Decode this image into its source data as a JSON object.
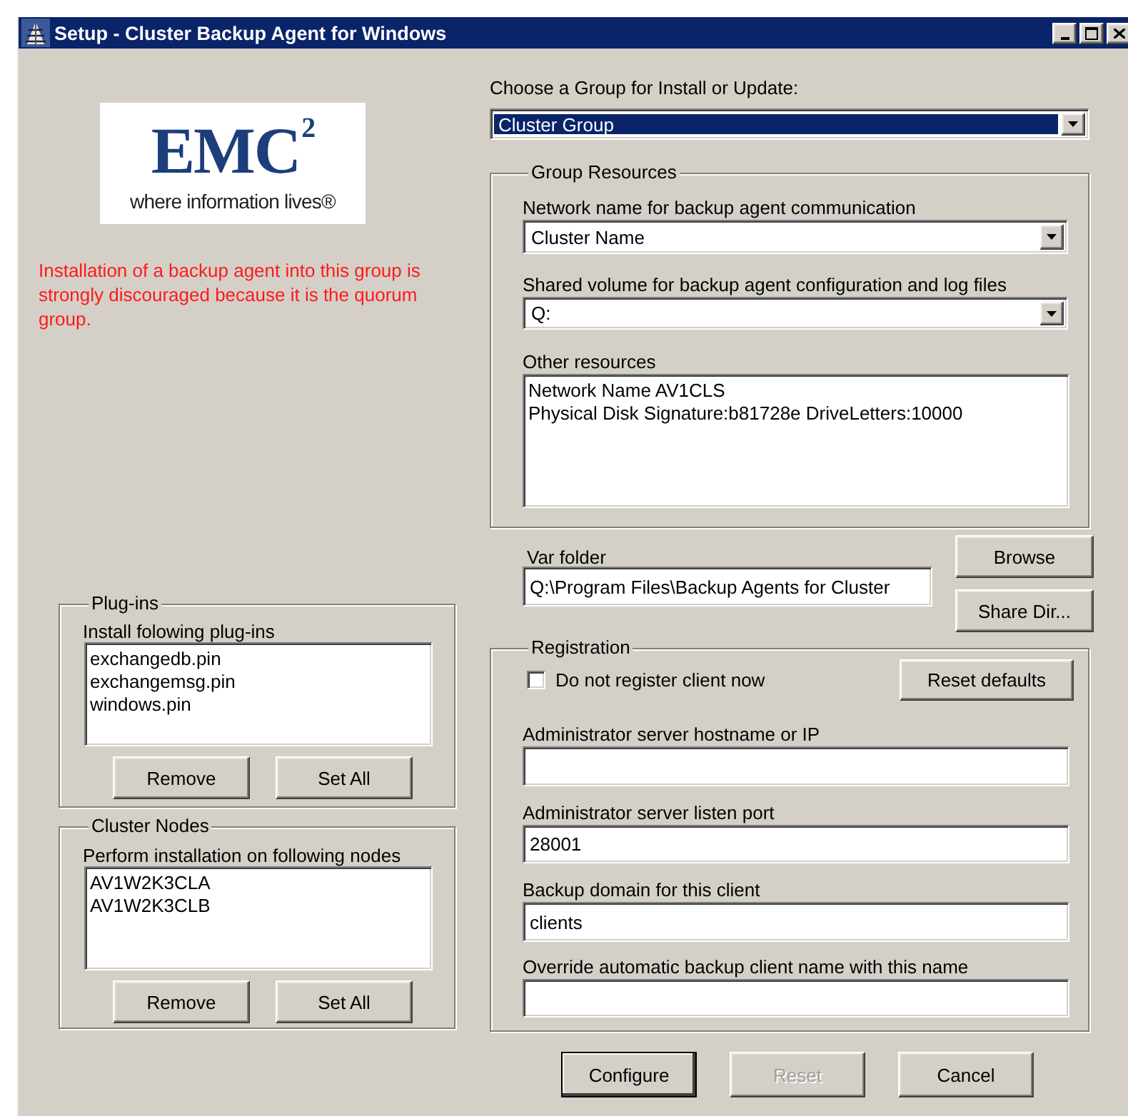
{
  "window": {
    "title": "Setup - Cluster Backup Agent for Windows"
  },
  "logo": {
    "wordmark": "EMC$^{2}$",
    "tagline": "where information lives®"
  },
  "warning": "Installation of a backup agent into this group is strongly discouraged because it is the quorum group.",
  "plugins": {
    "title": "Plug-ins",
    "label": "Install folowing plug-ins",
    "items": [
      "exchangedb.pin",
      "exchangemsg.pin",
      "windows.pin"
    ],
    "buttons": [
      "Remove",
      "Set All"
    ]
  },
  "cluster_nodes": {
    "title": "Cluster Nodes",
    "label": "Perform installation on following nodes",
    "items": [
      "AV1W2K3CLA",
      "AV1W2K3CLB"
    ],
    "buttons": [
      "Remove",
      "Set All"
    ]
  },
  "group_select": {
    "label": "Choose a Group for Install or Update:",
    "value": "Cluster Group",
    "focused": true
  },
  "group_resources": {
    "title": "Group Resources",
    "dropdowns": [
      {
        "label": "Network name for backup agent communication",
        "value": "Cluster Name"
      },
      {
        "label": "Shared volume for backup agent configuration and log files",
        "value": "Q:"
      }
    ],
    "other_resources": {
      "label": "Other resources",
      "lines": [
        "Network Name AV1CLS",
        "Physical Disk Signature:b81728e DriveLetters:10000"
      ]
    }
  },
  "var_folder": {
    "label": "Var folder",
    "value": "Q:\\Program Files\\Backup Agents for Cluster",
    "buttons": [
      "Browse",
      "Share Dir..."
    ]
  },
  "registration": {
    "title": "Registration",
    "checkbox": {
      "label": "Do not register client now",
      "checked": false
    },
    "reset_button": "Reset defaults",
    "fields": [
      {
        "label": "Administrator server hostname or IP"
      },
      {
        "label": "Administrator server listen port",
        "value": "28001"
      },
      {
        "label": "Backup domain for this client",
        "value": "clients"
      },
      {
        "label": "Override automatic backup client name with this name"
      }
    ]
  },
  "buttons": [
    {
      "label": "Configure",
      "disabled": false,
      "default": true
    },
    {
      "label": "Reset",
      "disabled": true,
      "default": false
    },
    {
      "label": "Cancel",
      "disabled": false,
      "default": false
    }
  ]
}
